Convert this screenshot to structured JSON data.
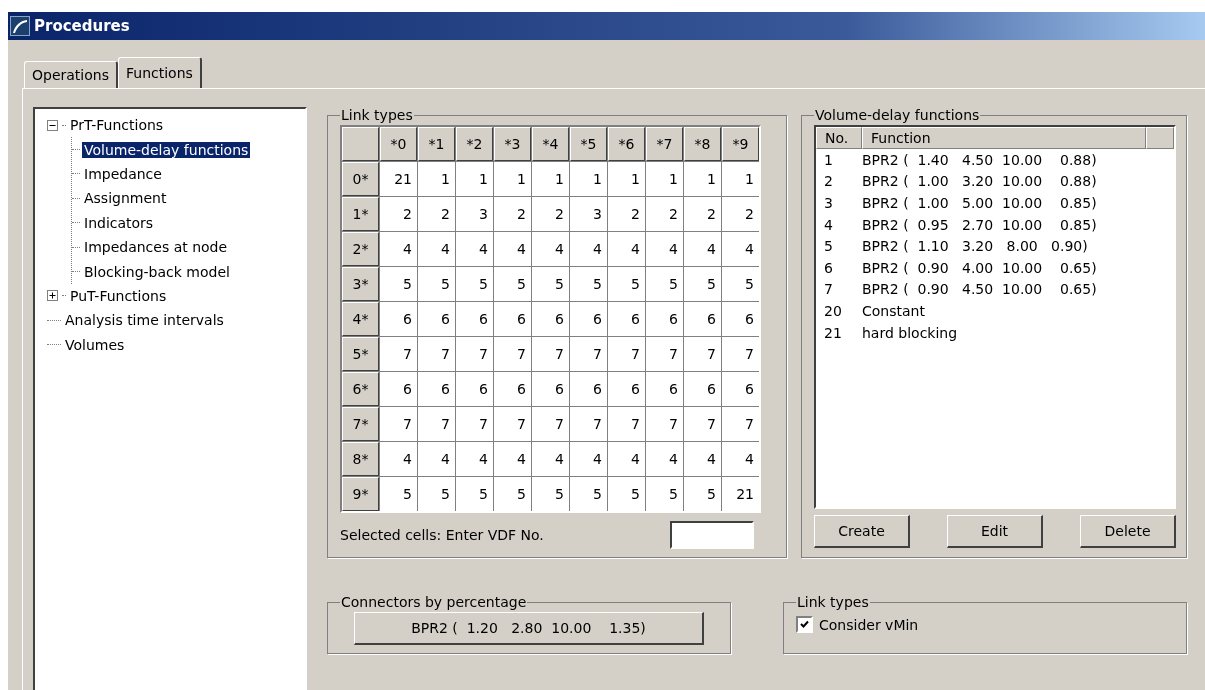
{
  "window": {
    "title": "Procedures"
  },
  "tabs": [
    {
      "label": "Operations",
      "selected": false
    },
    {
      "label": "Functions",
      "selected": true
    }
  ],
  "tree": [
    {
      "label": "PrT-Functions",
      "expanded": true,
      "selected": false,
      "children": [
        {
          "label": "Volume-delay functions",
          "selected": true
        },
        {
          "label": "Impedance",
          "selected": false
        },
        {
          "label": "Assignment",
          "selected": false
        },
        {
          "label": "Indicators",
          "selected": false
        },
        {
          "label": "Impedances at node",
          "selected": false
        },
        {
          "label": "Blocking-back model",
          "selected": false
        }
      ]
    },
    {
      "label": "PuT-Functions",
      "expanded": false,
      "selected": false
    },
    {
      "label": "Analysis time intervals",
      "selected": false
    },
    {
      "label": "Volumes",
      "selected": false
    }
  ],
  "link_types": {
    "title": "Link types",
    "columns": [
      "*0",
      "*1",
      "*2",
      "*3",
      "*4",
      "*5",
      "*6",
      "*7",
      "*8",
      "*9"
    ],
    "rows": [
      {
        "header": "0*",
        "cells": [
          "21",
          "1",
          "1",
          "1",
          "1",
          "1",
          "1",
          "1",
          "1",
          "1"
        ]
      },
      {
        "header": "1*",
        "cells": [
          "2",
          "2",
          "3",
          "2",
          "2",
          "3",
          "2",
          "2",
          "2",
          "2"
        ]
      },
      {
        "header": "2*",
        "cells": [
          "4",
          "4",
          "4",
          "4",
          "4",
          "4",
          "4",
          "4",
          "4",
          "4"
        ]
      },
      {
        "header": "3*",
        "cells": [
          "5",
          "5",
          "5",
          "5",
          "5",
          "5",
          "5",
          "5",
          "5",
          "5"
        ]
      },
      {
        "header": "4*",
        "cells": [
          "6",
          "6",
          "6",
          "6",
          "6",
          "6",
          "6",
          "6",
          "6",
          "6"
        ]
      },
      {
        "header": "5*",
        "cells": [
          "7",
          "7",
          "7",
          "7",
          "7",
          "7",
          "7",
          "7",
          "7",
          "7"
        ]
      },
      {
        "header": "6*",
        "cells": [
          "6",
          "6",
          "6",
          "6",
          "6",
          "6",
          "6",
          "6",
          "6",
          "6"
        ]
      },
      {
        "header": "7*",
        "cells": [
          "7",
          "7",
          "7",
          "7",
          "7",
          "7",
          "7",
          "7",
          "7",
          "7"
        ]
      },
      {
        "header": "8*",
        "cells": [
          "4",
          "4",
          "4",
          "4",
          "4",
          "4",
          "4",
          "4",
          "4",
          "4"
        ]
      },
      {
        "header": "9*",
        "cells": [
          "5",
          "5",
          "5",
          "5",
          "5",
          "5",
          "5",
          "5",
          "5",
          "21"
        ]
      }
    ],
    "entry_label": "Selected cells: Enter VDF No."
  },
  "vdf": {
    "title": "Volume-delay functions",
    "columns": [
      "No.",
      "Function"
    ],
    "rows": [
      {
        "no": "1",
        "function": "BPR2 (  1.40   4.50  10.00    0.88)"
      },
      {
        "no": "2",
        "function": "BPR2 (  1.00   3.20  10.00    0.88)"
      },
      {
        "no": "3",
        "function": "BPR2 (  1.00   5.00  10.00    0.85)"
      },
      {
        "no": "4",
        "function": "BPR2 (  0.95   2.70  10.00    0.85)"
      },
      {
        "no": "5",
        "function": "BPR2 (  1.10   3.20   8.00   0.90)"
      },
      {
        "no": "6",
        "function": "BPR2 (  0.90   4.00  10.00    0.65)"
      },
      {
        "no": "7",
        "function": "BPR2 (  0.90   4.50  10.00    0.65)"
      },
      {
        "no": "20",
        "function": "Constant"
      },
      {
        "no": "21",
        "function": "hard blocking"
      }
    ],
    "buttons": [
      "Create",
      "Edit",
      "Delete"
    ]
  },
  "connectors": {
    "title": "Connectors by percentage",
    "button": "BPR2 (  1.20   2.80  10.00    1.35)"
  },
  "link_options": {
    "title": "Link types",
    "checkbox": {
      "label": "Consider vMin",
      "checked": true
    }
  }
}
